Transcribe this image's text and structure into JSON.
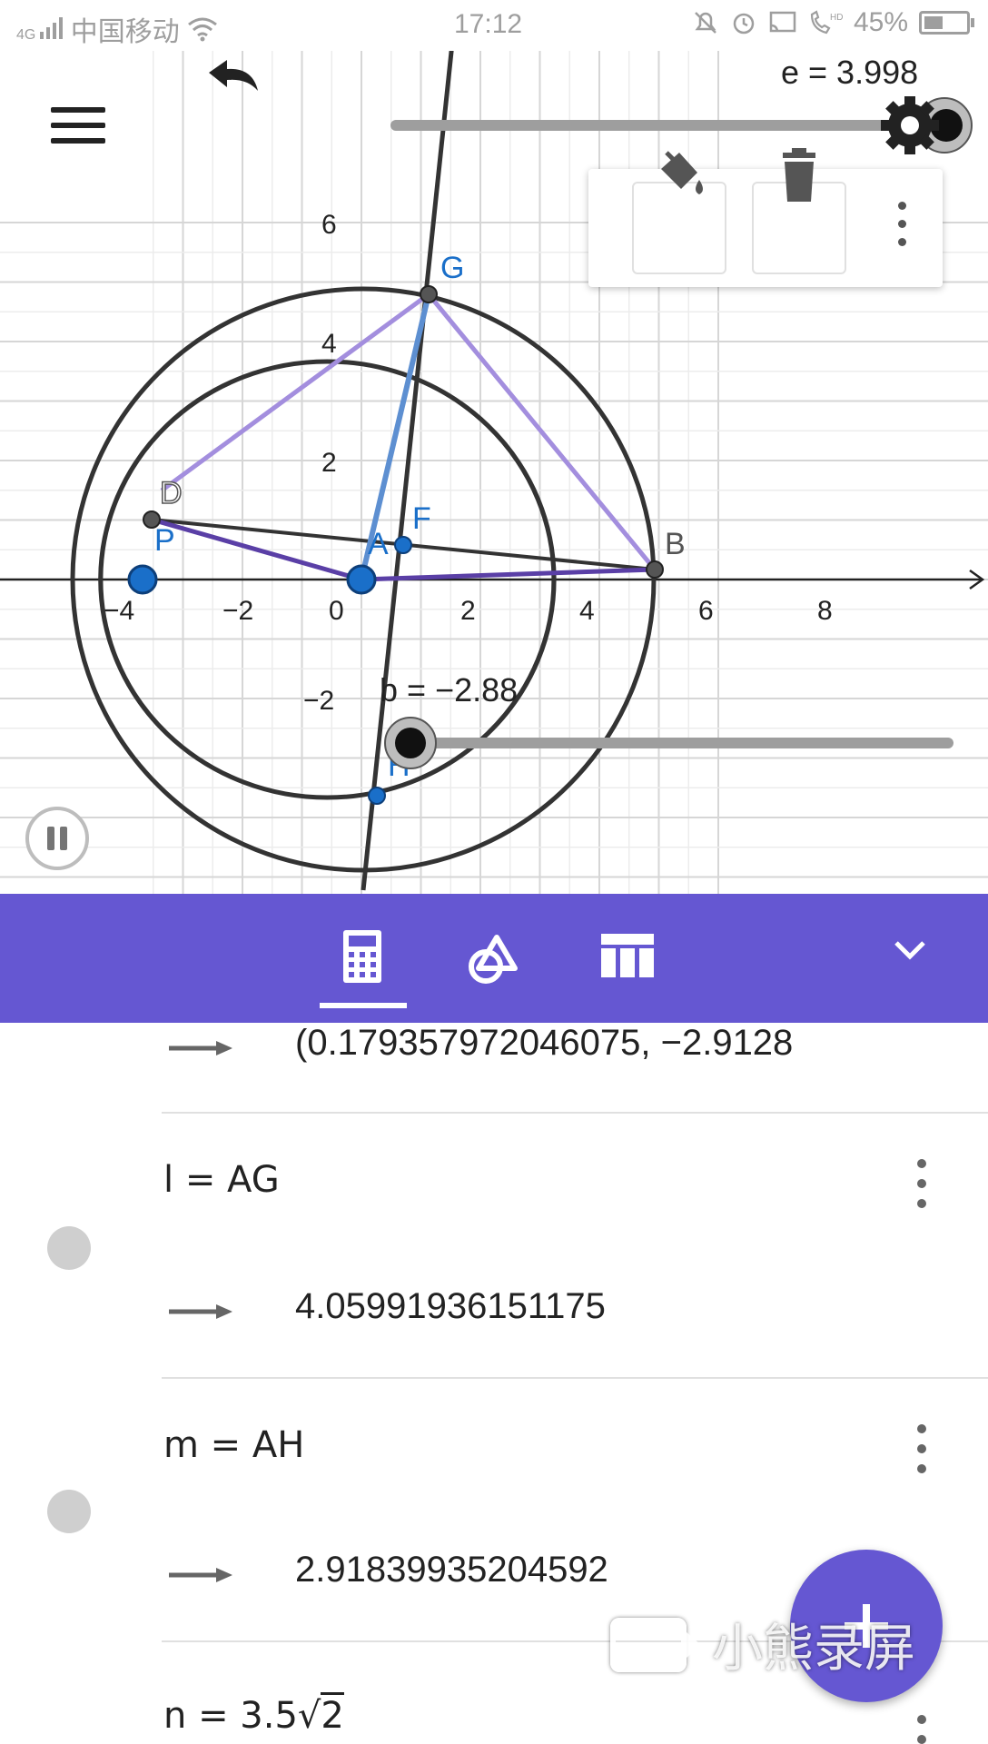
{
  "status_bar": {
    "network": "4G",
    "carrier": "中国移动",
    "time": "17:12",
    "battery_percent": "45%"
  },
  "graph": {
    "x_ticks": [
      "−4",
      "−2",
      "0",
      "2",
      "4",
      "6",
      "8"
    ],
    "y_ticks": [
      "6",
      "4",
      "2",
      "−2"
    ],
    "points": {
      "G": "G",
      "D": "D",
      "F": "F",
      "A": "A",
      "P": "P",
      "B": "B",
      "H": "H"
    },
    "slider_e_label": "e = 3.998",
    "slider_b_label": "b = −2.88",
    "slider_e_value": 3.998,
    "slider_b_value": -2.88
  },
  "toolbar": {
    "icons": [
      "calculator-icon",
      "tools-icon",
      "table-icon",
      "chevron-down-icon"
    ],
    "accent": "#6557d2"
  },
  "algebra": {
    "rows": [
      {
        "result": "(0.179357972046075, −2.9128"
      },
      {
        "definition": "l  =  AG",
        "result": "4.05991936151175"
      },
      {
        "definition": "m  =  AH",
        "result": "2.91839935204592"
      },
      {
        "definition_prefix": "n  =  3.5",
        "definition_sqrt": "2"
      }
    ]
  },
  "watermark": {
    "text": "小熊录屏"
  }
}
